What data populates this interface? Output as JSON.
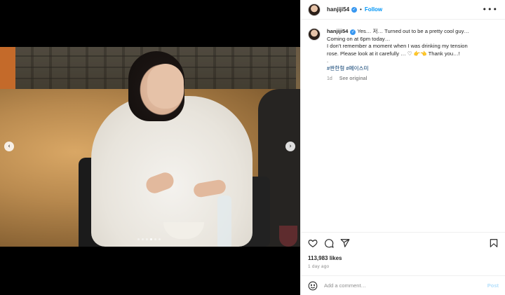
{
  "post": {
    "username": "hanjiji54",
    "follow_label": "Follow",
    "more_label": "•••",
    "dot_separator": "•",
    "caption_lines": [
      "Yes… 저… Turned out to be a pretty cool guy…",
      "Coming on at 6pm today…",
      "I don't remember a moment when I was drinking my tension",
      "rose. Please look at it carefully … ♡ 👉👈 Thank you…!",
      "."
    ],
    "hashtags": [
      "#짠한형",
      "#페이스미"
    ],
    "time_ago_short": "1d",
    "see_original_label": "See original",
    "likes": "113,983 likes",
    "time_ago": "1 day ago",
    "comment_placeholder": "Add a comment…",
    "post_label": "Post"
  },
  "carousel": {
    "prev_label": "‹",
    "next_label": "›",
    "total_slides": 6,
    "current_slide": 3
  },
  "icons": {
    "verified": "verified-badge-icon",
    "like": "heart-icon",
    "comment": "comment-bubble-icon",
    "share": "paper-plane-icon",
    "save": "bookmark-icon",
    "emoji": "emoji-smile-icon"
  },
  "colors": {
    "accent": "#0095f6",
    "verified": "#3897f0",
    "hashtag": "#00376b",
    "muted": "#8e8e8e",
    "post_disabled": "#b2dffc"
  }
}
